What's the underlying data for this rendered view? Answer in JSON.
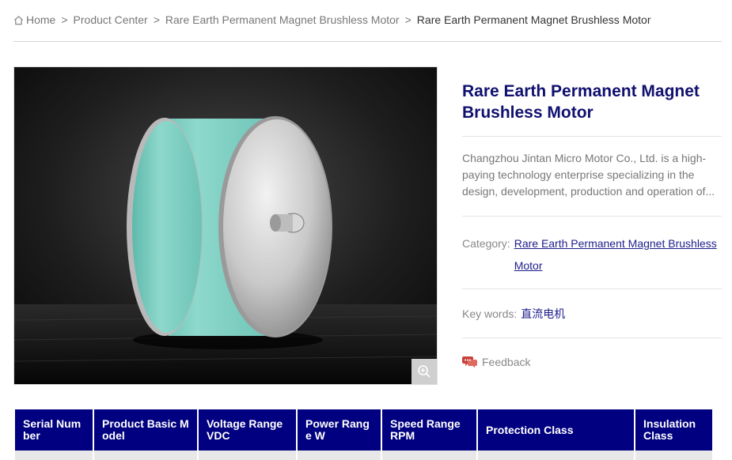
{
  "breadcrumb": {
    "home": "Home",
    "items": [
      "Product Center",
      "Rare Earth Permanent Magnet Brushless Motor",
      "Rare Earth Permanent Magnet Brushless Motor"
    ]
  },
  "product": {
    "title": "Rare Earth Permanent Magnet Brushless Motor",
    "description": "Changzhou Jintan Micro Motor Co., Ltd. is a high-paying technology enterprise specializing in the design, development, production and operation of...",
    "category_label": "Category:",
    "category_value": "Rare Earth Permanent Magnet Brushless Motor",
    "keywords_label": "Key words:",
    "keywords_value": "直流电机",
    "feedback_label": "Feedback"
  },
  "spec_table": {
    "headers": [
      "Serial Number",
      "Product Basic Model",
      "Voltage Range VDC",
      "Power Range W",
      "Speed Range RPM",
      "Protection Class",
      "Insulation Class"
    ]
  },
  "colors": {
    "title": "#10106f",
    "table_header": "#000080",
    "link": "#1d1d8c",
    "feedback_icon": "#c8433a"
  },
  "icons": [
    "home-icon",
    "zoom-in-icon",
    "feedback-chat-icon"
  ]
}
